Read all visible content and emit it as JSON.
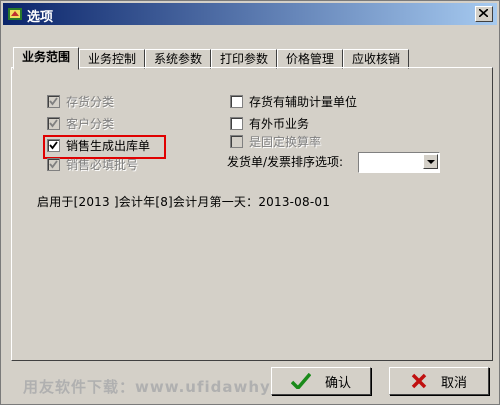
{
  "window": {
    "title": "选项"
  },
  "tabs": [
    {
      "label": "业务范围",
      "active": true
    },
    {
      "label": "业务控制"
    },
    {
      "label": "系统参数"
    },
    {
      "label": "打印参数"
    },
    {
      "label": "价格管理"
    },
    {
      "label": "应收核销"
    }
  ],
  "options_left": [
    {
      "label": "存货分类",
      "checked": true,
      "disabled": true
    },
    {
      "label": "客户分类",
      "checked": true,
      "disabled": true
    },
    {
      "label": "销售生成出库单",
      "checked": true,
      "disabled": false
    },
    {
      "label": "销售必填批号",
      "checked": true,
      "disabled": true
    }
  ],
  "options_right": [
    {
      "label": "存货有辅助计量单位",
      "checked": false,
      "disabled": false
    },
    {
      "label": "有外币业务",
      "checked": false,
      "disabled": false
    },
    {
      "label": "是固定换算率",
      "checked": false,
      "disabled": true
    }
  ],
  "sort": {
    "label": "发货单/发票排序选项:",
    "value": ""
  },
  "info": "启用于[2013 ]会计年[8]会计月第一天：2013-08-01",
  "watermark": "用友软件下载：www.ufidawhy.com",
  "buttons": {
    "ok": "确认",
    "cancel": "取消"
  }
}
